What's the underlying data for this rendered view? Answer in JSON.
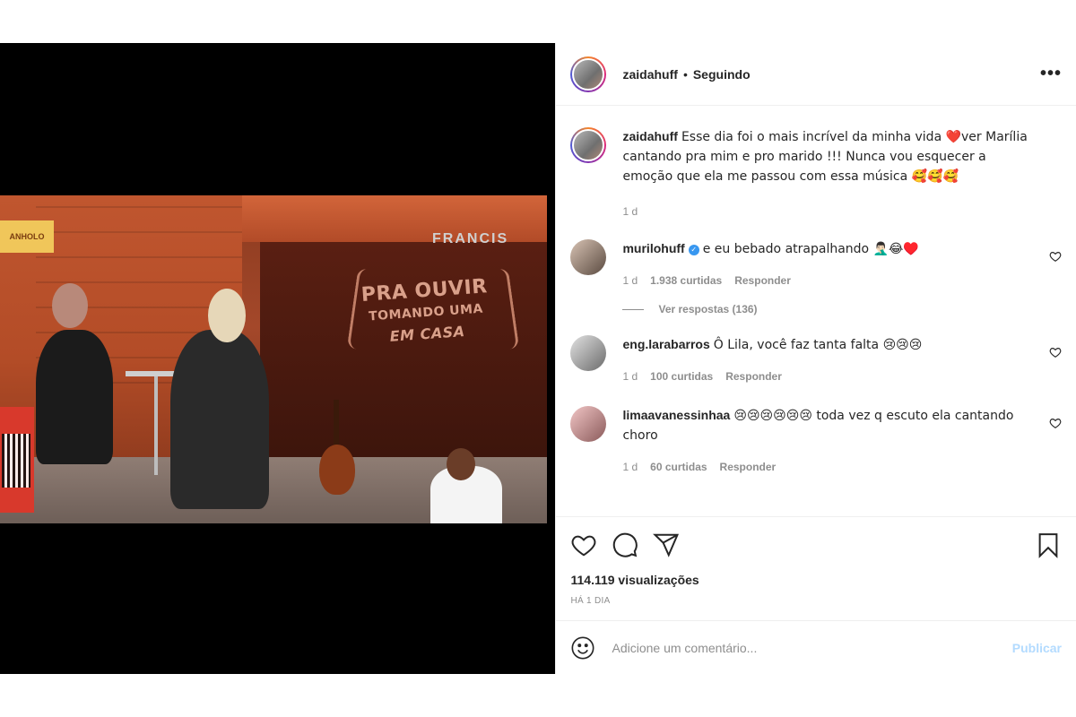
{
  "header": {
    "username": "zaidahuff",
    "separator": "•",
    "follow_status": "Seguindo",
    "more_label": "•••"
  },
  "caption": {
    "username": "zaidahuff",
    "text": "Esse dia foi o mais incrível da minha vida ❤️ver Marília cantando pra mim e pro marido !!! Nunca vou esquecer a emoção que ela me passou com essa música 🥰🥰🥰",
    "time": "1 d"
  },
  "comments": [
    {
      "username": "murilohuff",
      "verified": true,
      "text": "e eu bebado atrapalhando 🤦🏻‍♂️😂♥️",
      "time": "1 d",
      "likes": "1.938 curtidas",
      "reply_label": "Responder",
      "view_replies": "Ver respostas (136)"
    },
    {
      "username": "eng.larabarros",
      "verified": false,
      "text": "Ô Lila, você faz tanta falta 😢😢😢",
      "time": "1 d",
      "likes": "100 curtidas",
      "reply_label": "Responder"
    },
    {
      "username": "limaavanessinhaa",
      "verified": false,
      "text": "😢😢😢😢😢😢 toda vez q escuto ela cantando choro",
      "time": "1 d",
      "likes": "60 curtidas",
      "reply_label": "Responder"
    }
  ],
  "stats": {
    "views": "114.119 visualizações",
    "date": "HÁ 1 DIA"
  },
  "add_comment": {
    "placeholder": "Adicione um comentário...",
    "publish_label": "Publicar"
  },
  "video": {
    "stage_title_1": "PRA OUVIR",
    "stage_title_2": "TOMANDO UMA",
    "stage_title_3": "EM CASA",
    "brand": "FRANCIS",
    "sign": "ANHOLO"
  },
  "colors": {
    "link_disabled": "#b3dbff",
    "verified": "#3897f0",
    "muted": "#8e8e8e",
    "text": "#262626"
  },
  "icons": [
    "more-options-icon",
    "heart-icon",
    "comment-icon",
    "share-icon",
    "bookmark-icon",
    "emoji-icon",
    "verified-icon"
  ]
}
